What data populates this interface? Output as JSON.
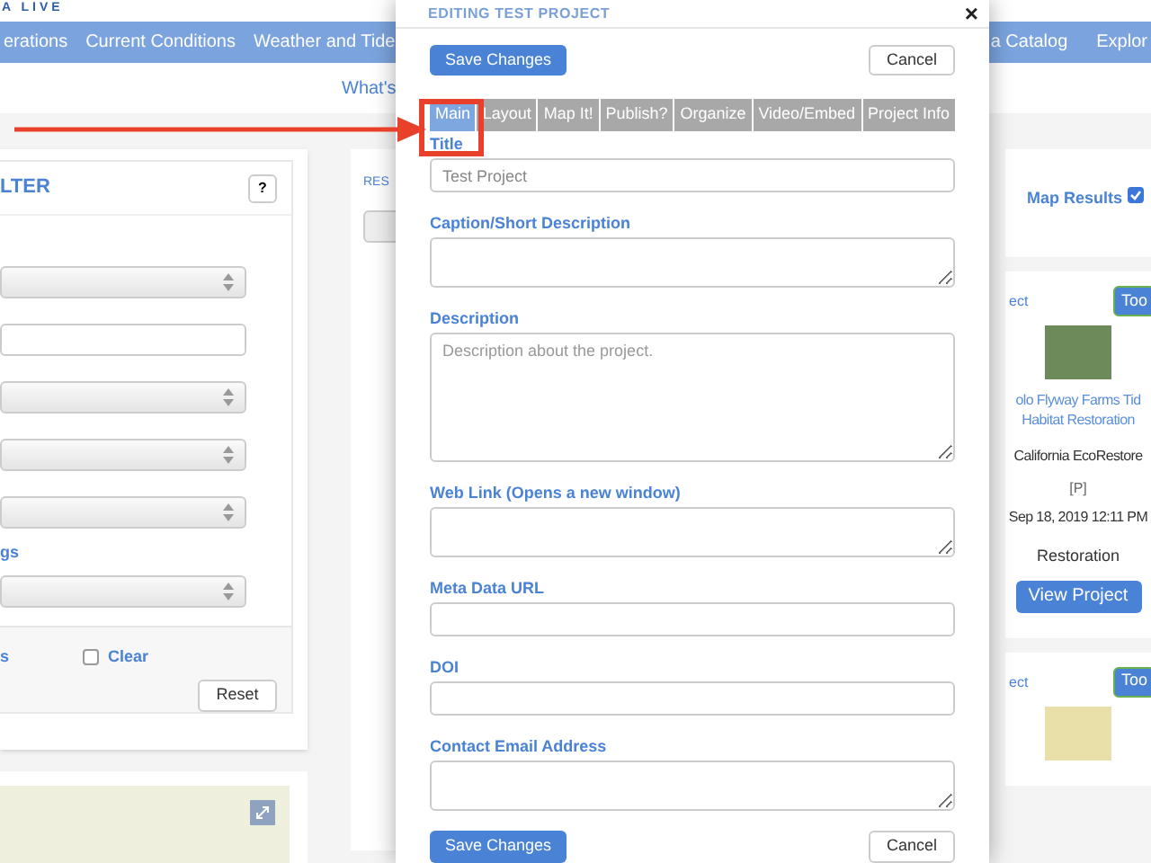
{
  "site": {
    "logo": "A LIVE",
    "nav_left": [
      "erations",
      "Current Conditions",
      "Weather and Tide"
    ],
    "nav_right": [
      "a Catalog",
      "Explor"
    ],
    "subnav": "What's"
  },
  "filter_panel": {
    "title": "LTER",
    "help": "?",
    "fields": [
      {
        "kind": "select"
      },
      {
        "kind": "input"
      },
      {
        "kind": "select"
      },
      {
        "kind": "select"
      },
      {
        "kind": "select"
      },
      {
        "kind": "label",
        "text": "gs"
      },
      {
        "kind": "select"
      }
    ],
    "footer_link": "s",
    "clear": {
      "label": "Clear",
      "checked": false
    },
    "reset": "Reset"
  },
  "results_panel": {
    "title": "RES"
  },
  "right_panel": {
    "map_results": {
      "label": "Map Results",
      "checked": true
    },
    "cards": [
      {
        "link": "ect",
        "button": "Too",
        "title_lines": [
          "olo Flyway Farms Tid",
          "Habitat Restoration"
        ],
        "program": "California EcoRestore",
        "tag": "[P]",
        "date": "Sep 18, 2019 12:11 PM",
        "category": "Restoration",
        "action": "View Project"
      },
      {
        "link": "ect",
        "button": "Too"
      }
    ]
  },
  "modal": {
    "title": "EDITING TEST PROJECT",
    "close": "×",
    "save": "Save Changes",
    "cancel": "Cancel",
    "tabs": [
      {
        "label": "Main",
        "selected": true
      },
      {
        "label": "Layout",
        "selected": false
      },
      {
        "label": "Map It!",
        "selected": false
      },
      {
        "label": "Publish?",
        "selected": false
      },
      {
        "label": "Organize",
        "selected": false
      },
      {
        "label": "Video/Embed",
        "selected": false
      },
      {
        "label": "Project Info",
        "selected": false
      }
    ],
    "fields": [
      {
        "kind": "input",
        "label": "Title",
        "value": "Test Project"
      },
      {
        "kind": "textarea",
        "label": "Caption/Short Description"
      },
      {
        "kind": "textarea-large",
        "label": "Description",
        "placeholder": "Description about the project."
      },
      {
        "kind": "textarea",
        "label": "Web Link (Opens a new window)"
      },
      {
        "kind": "input",
        "label": "Meta Data URL"
      },
      {
        "kind": "input",
        "label": "DOI"
      },
      {
        "kind": "textarea",
        "label": "Contact Email Address"
      }
    ],
    "footer_save": "Save Changes",
    "footer_cancel": "Cancel"
  }
}
